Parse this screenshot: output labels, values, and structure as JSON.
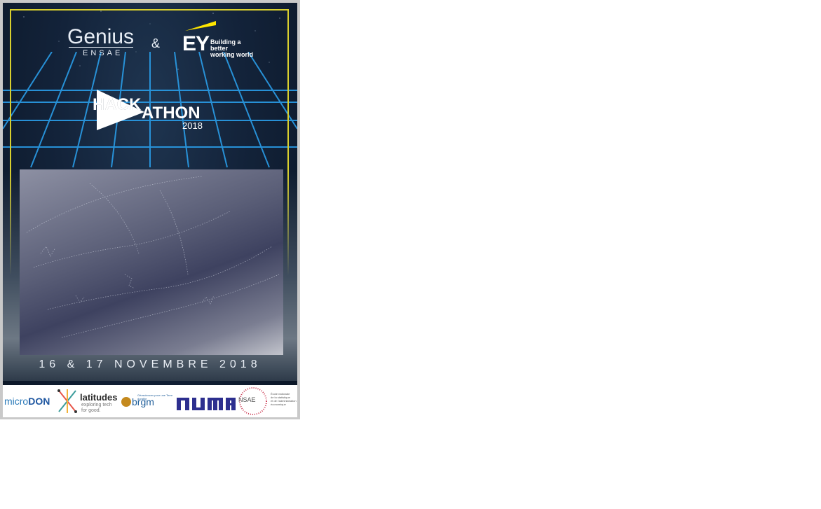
{
  "poster": {
    "brand_genius": "Genius",
    "brand_ensae": "ENSAE",
    "ampersand": "&",
    "brand_ey": "EY",
    "ey_tagline_1": "Building a better",
    "ey_tagline_2": "working world",
    "hack": "HACK",
    "athon": "ATHON",
    "year": "2018",
    "date": "16 & 17 NOVEMBRE 2018"
  },
  "sponsors": {
    "microdon_a": "micro",
    "microdon_b": "DON",
    "latitudes": "latitudes",
    "latitudes_tag_1": "exploring tech",
    "latitudes_tag_2": "for good.",
    "brgm": "brgm",
    "brgm_tag": "Géosciences pour une Terre durable",
    "numa": "NUMA",
    "nsae": "NSAE",
    "nsae_tag_1": "École nationale",
    "nsae_tag_2": "de la statistique",
    "nsae_tag_3": "et de l'administration",
    "nsae_tag_4": "économique"
  },
  "colors": {
    "frame_border": "#d8cf2e",
    "grid_lines": "#2a9de8",
    "ey_yellow": "#ffe600"
  }
}
